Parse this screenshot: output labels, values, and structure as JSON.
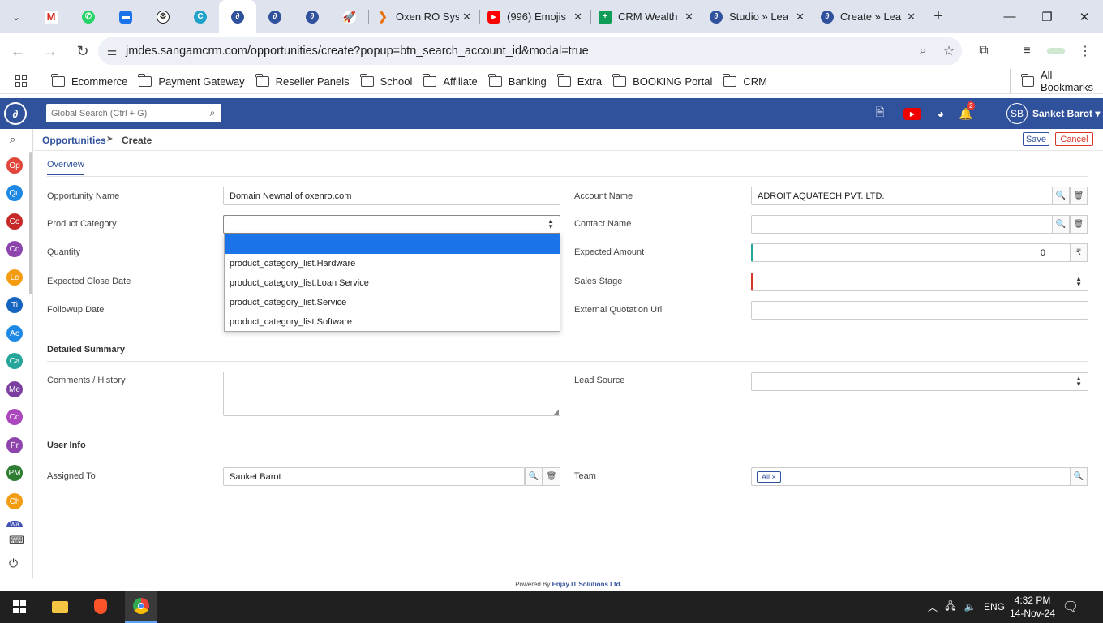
{
  "browser": {
    "tabs": [
      {
        "title": "Oxen RO Sys"
      },
      {
        "title": "(996) Emojis"
      },
      {
        "title": "CRM Wealth"
      },
      {
        "title": "Studio » Lea"
      },
      {
        "title": "Create » Lea"
      }
    ],
    "url": "jmdes.sangamcrm.com/opportunities/create?popup=btn_search_account_id&modal=true",
    "bookmarks": [
      "Ecommerce",
      "Payment Gateway",
      "Reseller Panels",
      "School",
      "Affiliate",
      "Banking",
      "Extra",
      "BOOKING Portal",
      "CRM"
    ],
    "all_bookmarks": "All Bookmarks"
  },
  "app": {
    "search_placeholder": "Global Search (Ctrl + G)",
    "notification_count": "2",
    "user_initials": "SB",
    "user_name": "Sanket Barot",
    "sidebar": [
      "Op",
      "Qu",
      "Co",
      "Co",
      "Le",
      "Ti",
      "Ac",
      "Ca",
      "Me",
      "Co",
      "Pr",
      "PM",
      "Ch",
      "Wa"
    ],
    "sidebar_colors": [
      "#e2463a",
      "#1e88e5",
      "#c62828",
      "#8e44ad",
      "#f39c12",
      "#1565c0",
      "#1e88e5",
      "#26a69a",
      "#7b3fa0",
      "#ab47bc",
      "#8e44ad",
      "#2e7d32",
      "#f39c12",
      "#3f51b5"
    ]
  },
  "breadcrumb": {
    "module": "Opportunities",
    "action": "Create"
  },
  "actions": {
    "save": "Save",
    "cancel": "Cancel"
  },
  "form": {
    "tab": "Overview",
    "opportunity_name_label": "Opportunity Name",
    "opportunity_name": "Domain Newnal of oxenro.com",
    "product_category_label": "Product Category",
    "quantity_label": "Quantity",
    "expected_close_date_label": "Expected Close Date",
    "followup_date_label": "Followup Date",
    "account_name_label": "Account Name",
    "account_name": "ADROIT AQUATECH PVT. LTD.",
    "contact_name_label": "Contact Name",
    "expected_amount_label": "Expected Amount",
    "expected_amount": "0",
    "currency_symbol": "₹",
    "sales_stage_label": "Sales Stage",
    "external_quotation_label": "External Quotation Url",
    "detailed_summary": "Detailed Summary",
    "comments_label": "Comments / History",
    "lead_source_label": "Lead Source",
    "user_info": "User Info",
    "assigned_to_label": "Assigned To",
    "assigned_to": "Sanket Barot",
    "team_label": "Team",
    "team_tag": "All",
    "product_category_options": [
      "product_category_list.Hardware",
      "product_category_list.Loan Service",
      "product_category_list.Service",
      "product_category_list.Software"
    ]
  },
  "footer": {
    "prefix": "Powered By",
    "company": "Enjay IT Solutions Ltd."
  },
  "taskbar": {
    "lang": "ENG",
    "time": "4:32 PM",
    "date": "14-Nov-24"
  }
}
